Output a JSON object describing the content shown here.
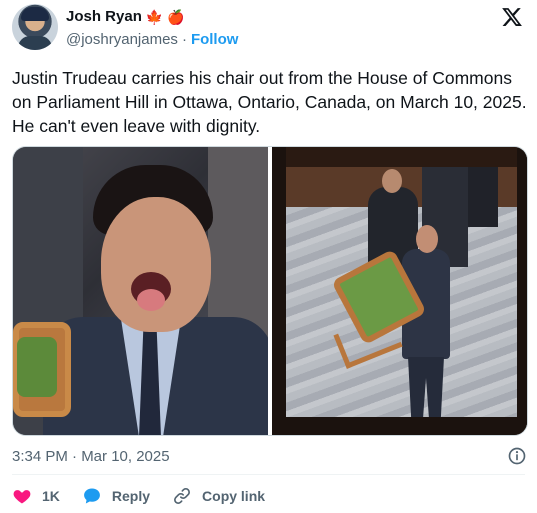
{
  "author": {
    "name": "Josh Ryan",
    "badges": [
      "🍁",
      "🍎"
    ],
    "handle": "@joshryanjames",
    "separator": "·",
    "follow_label": "Follow"
  },
  "tweet": {
    "text": "Justin Trudeau carries his chair out from the House of Commons on Parliament Hill in Ottawa, Ontario, Canada, on March 10, 2025. He can't even leave with dignity.",
    "timestamp": "3:34 PM · Mar 10, 2025"
  },
  "actions": {
    "like_count": "1K",
    "reply_label": "Reply",
    "copy_link_label": "Copy link"
  },
  "colors": {
    "accent": "#1d9bf0",
    "like": "#f91880",
    "text_secondary": "#536471"
  },
  "icons": {
    "brand": "x-logo-icon",
    "info": "info-icon",
    "like": "heart-icon",
    "reply": "speech-bubble-icon",
    "copy": "link-icon"
  }
}
